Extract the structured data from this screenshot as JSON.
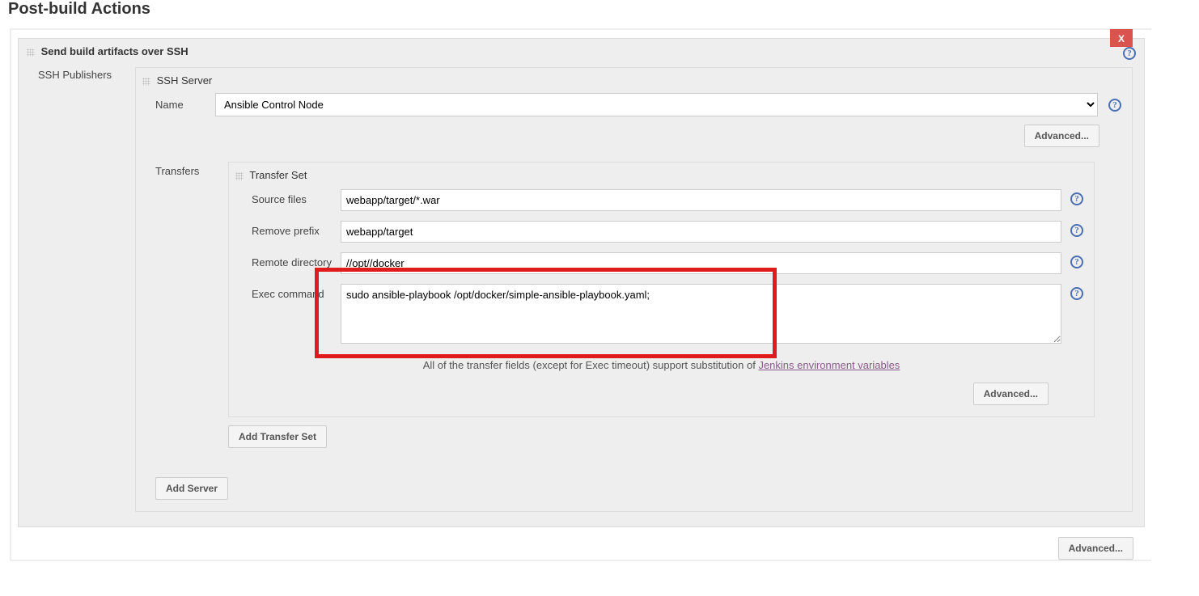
{
  "page": {
    "title": "Post-build Actions"
  },
  "section": {
    "title": "Send build artifacts over SSH",
    "close_label": "X",
    "publishers_label": "SSH Publishers"
  },
  "ssh_server": {
    "header": "SSH Server",
    "name_label": "Name",
    "name_value": "Ansible Control Node",
    "advanced_label": "Advanced..."
  },
  "transfers": {
    "label": "Transfers",
    "set_header": "Transfer Set",
    "source_files_label": "Source files",
    "source_files_value": "webapp/target/*.war",
    "remove_prefix_label": "Remove prefix",
    "remove_prefix_value": "webapp/target",
    "remote_dir_label": "Remote directory",
    "remote_dir_value": "//opt//docker",
    "exec_label": "Exec command",
    "exec_value": "sudo ansible-playbook /opt/docker/simple-ansible-playbook.yaml;",
    "note_prefix": "All of the transfer fields (except for Exec timeout) support substitution of ",
    "note_link": "Jenkins environment variables",
    "advanced_label": "Advanced...",
    "add_transfer_label": "Add Transfer Set"
  },
  "footer": {
    "add_server_label": "Add Server",
    "advanced_label": "Advanced..."
  }
}
